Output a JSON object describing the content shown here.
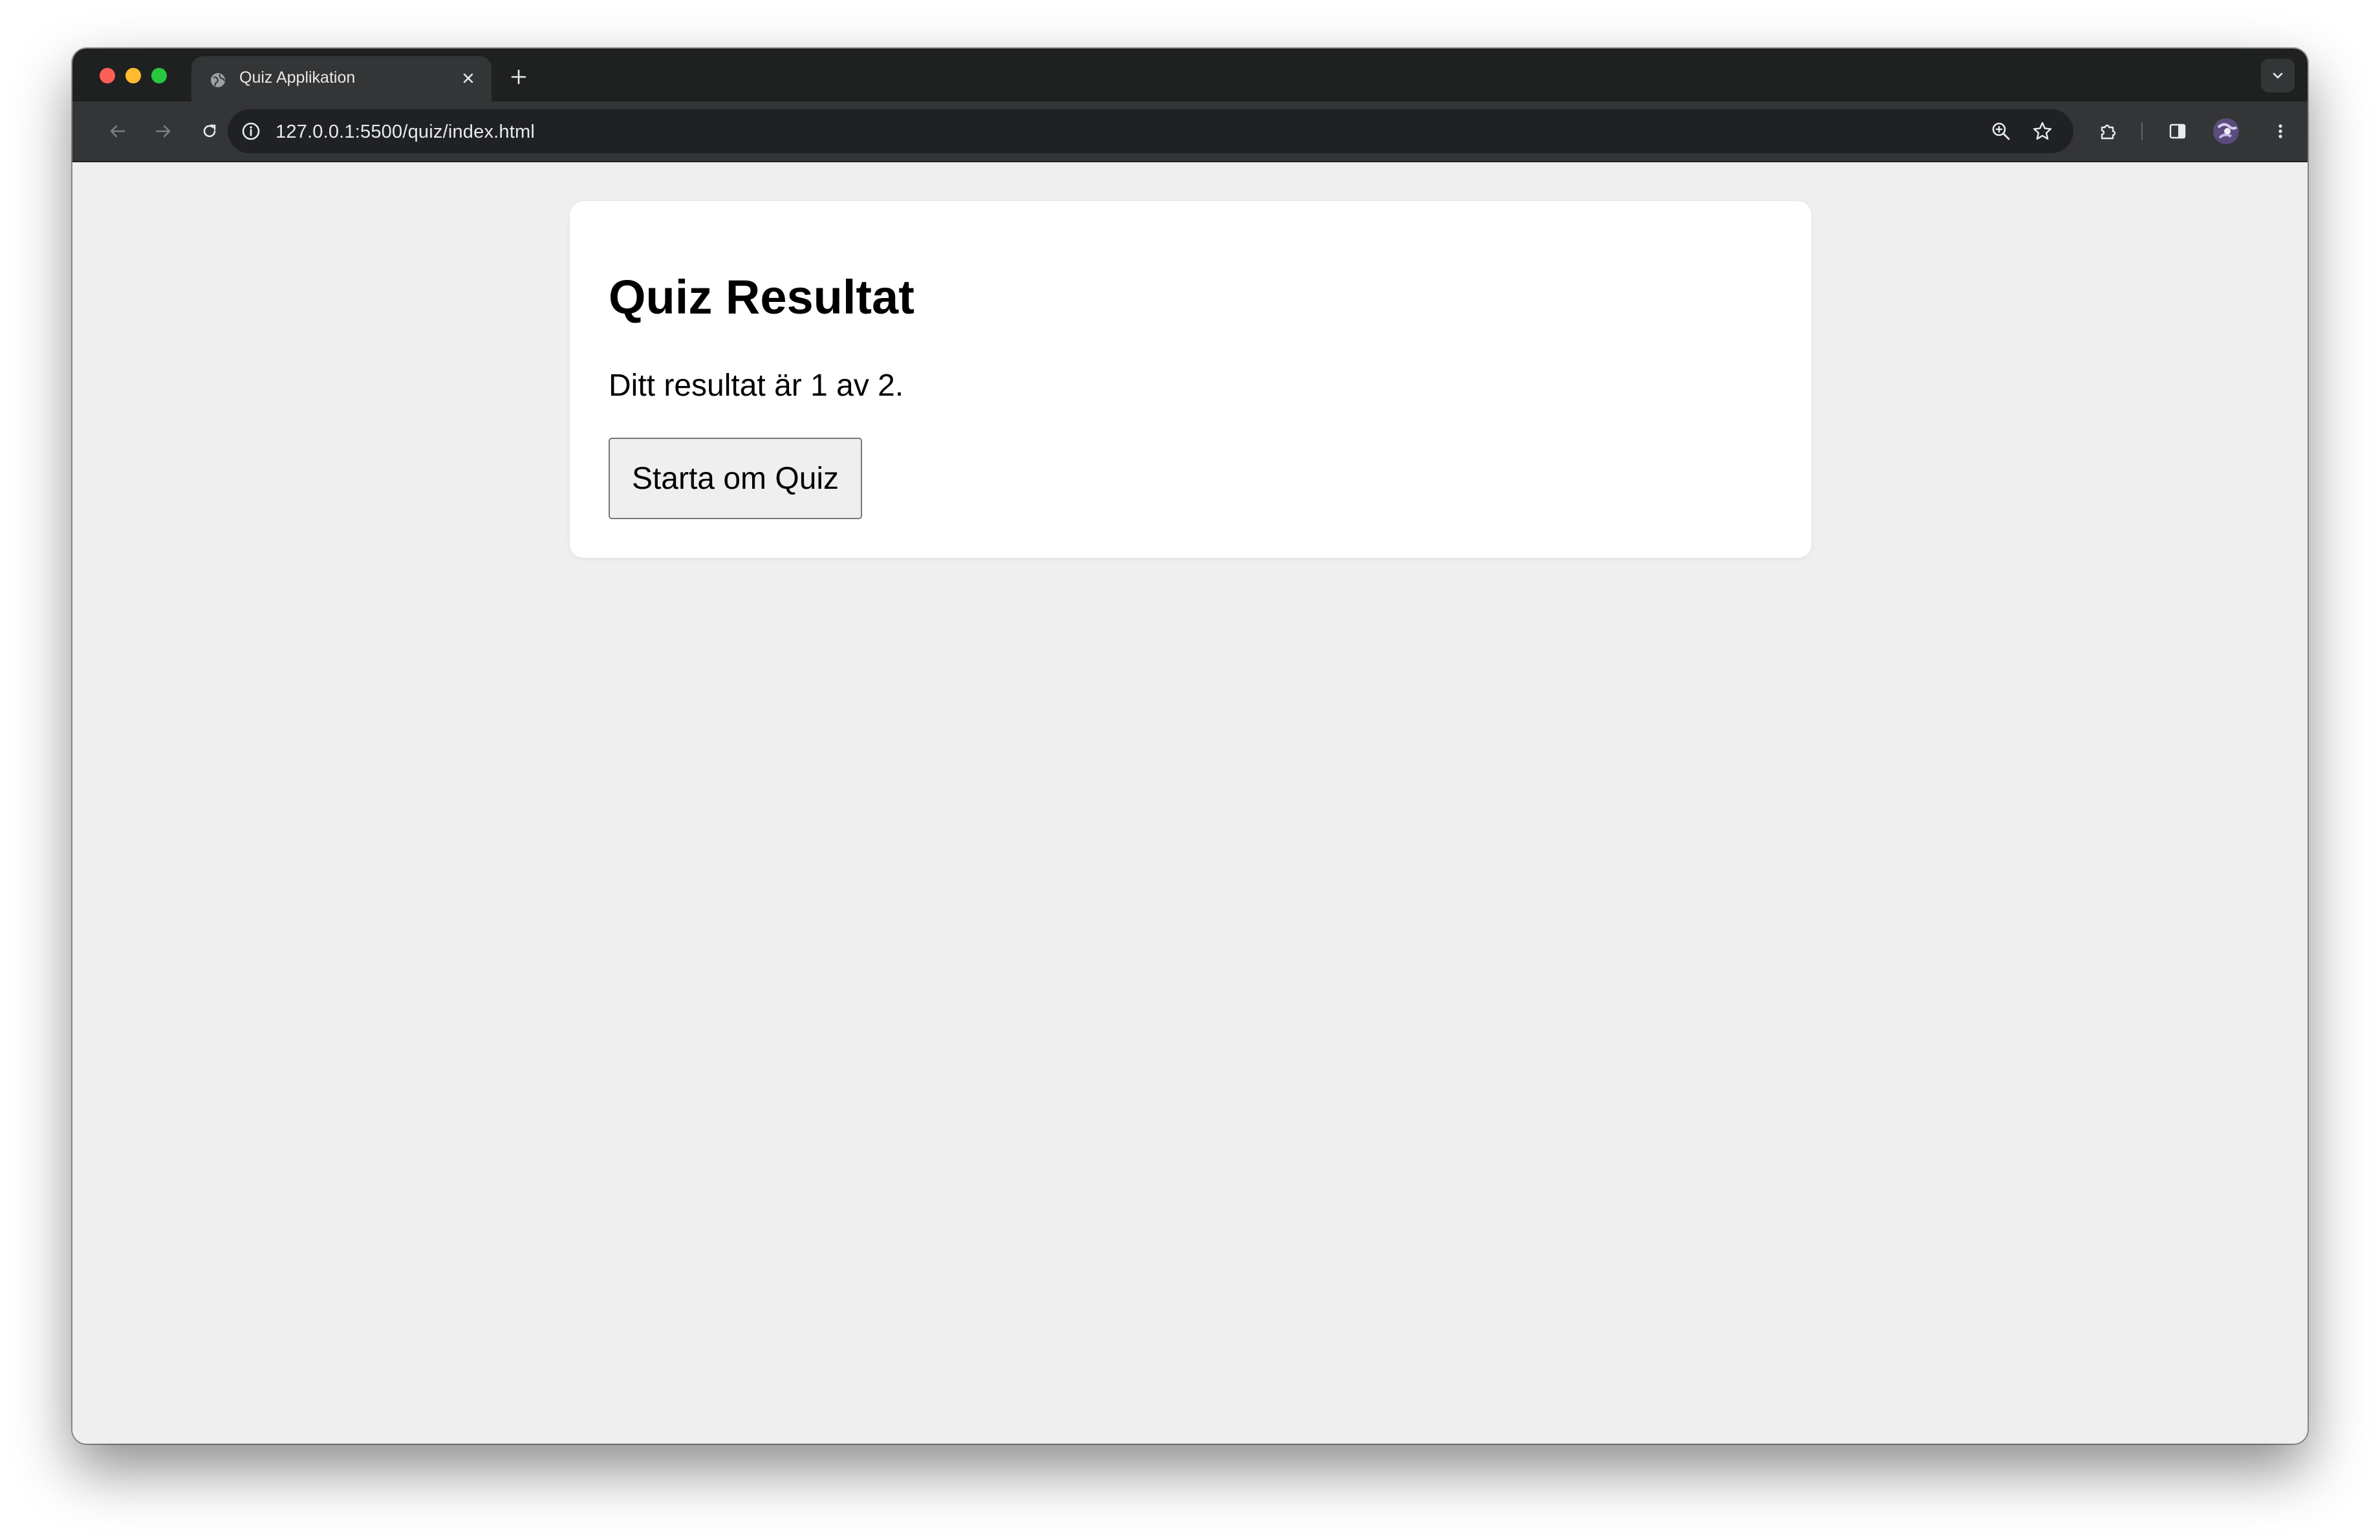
{
  "browser": {
    "tab": {
      "title": "Quiz Applikation"
    },
    "address_bar": {
      "url": "127.0.0.1:5500/quiz/index.html"
    }
  },
  "page": {
    "heading": "Quiz Resultat",
    "result_text": "Ditt resultat är 1 av 2.",
    "restart_button_label": "Starta om Quiz"
  },
  "colors": {
    "page_background": "#efefef",
    "card_background": "#ffffff",
    "browser_frame": "#1f2020",
    "toolbar": "#333536"
  }
}
